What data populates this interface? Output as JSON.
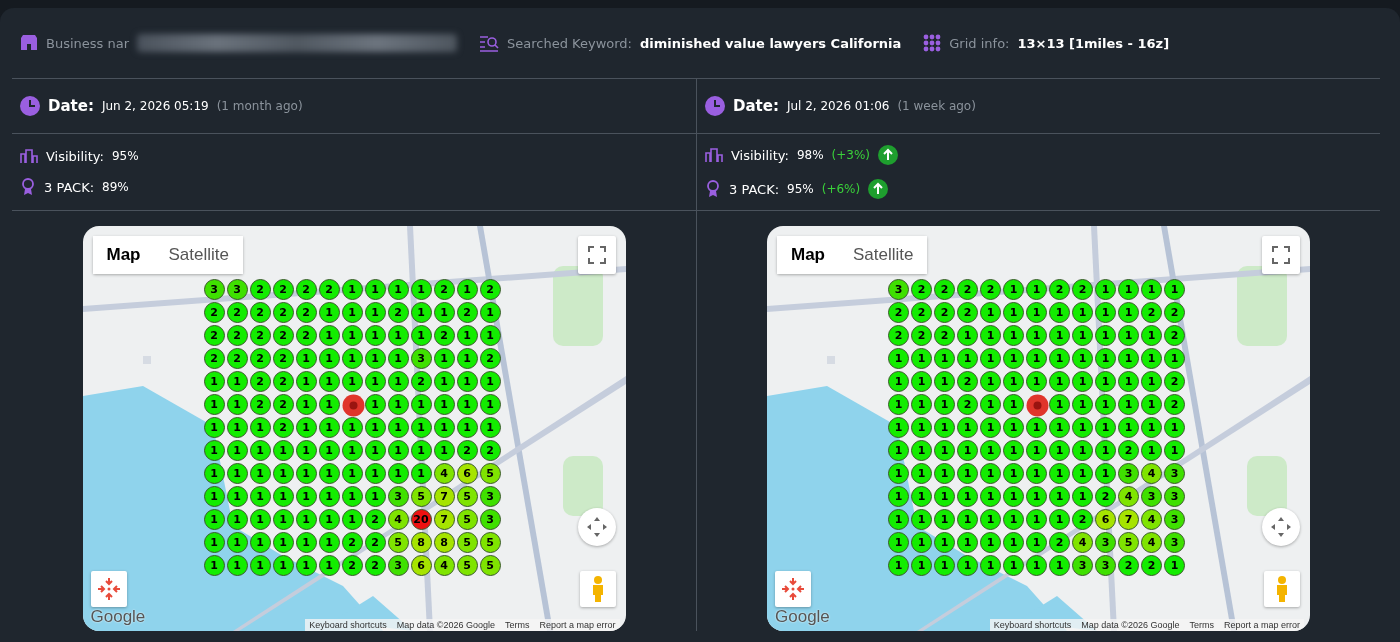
{
  "header": {
    "business_label": "Business nar",
    "keyword_label": "Searched Keyword:",
    "keyword": "diminished value lawyers California",
    "grid_label": "Grid info:",
    "grid_value": "13×13 [1miles - 16z]"
  },
  "reports": [
    {
      "date_label": "Date:",
      "date": "Jun 2, 2026 05:19",
      "ago": "(1 month ago)",
      "stats": [
        {
          "kind": "visibility",
          "label": "Visibility:",
          "value": "95%"
        },
        {
          "kind": "pack",
          "label": "3 PACK:",
          "value": "89%"
        }
      ],
      "map": {
        "map_types": [
          {
            "label": "Map",
            "selected": true
          },
          {
            "label": "Satellite",
            "selected": false
          }
        ],
        "logo": "Google",
        "footer": [
          "Keyboard shortcuts",
          "Map data ©2026 Google",
          "Terms",
          "Report a map error"
        ],
        "grid": [
          [
            "3",
            "3",
            "2",
            "2",
            "2",
            "2",
            "1",
            "1",
            "1",
            "1",
            "2",
            "1",
            "2"
          ],
          [
            "2",
            "2",
            "2",
            "2",
            "2",
            "1",
            "1",
            "1",
            "2",
            "1",
            "1",
            "2",
            "1"
          ],
          [
            "2",
            "2",
            "2",
            "2",
            "2",
            "1",
            "1",
            "1",
            "1",
            "1",
            "2",
            "1",
            "1"
          ],
          [
            "2",
            "2",
            "2",
            "2",
            "1",
            "1",
            "1",
            "1",
            "1",
            "3",
            "1",
            "1",
            "2"
          ],
          [
            "1",
            "1",
            "2",
            "2",
            "1",
            "1",
            "1",
            "1",
            "1",
            "2",
            "1",
            "1",
            "1"
          ],
          [
            "1",
            "1",
            "2",
            "2",
            "1",
            "1",
            {
              "kind": "pin"
            },
            "1",
            "1",
            "1",
            "1",
            "1",
            "1"
          ],
          [
            "1",
            "1",
            "1",
            "2",
            "1",
            "1",
            "1",
            "1",
            "1",
            "1",
            "1",
            "1",
            "1"
          ],
          [
            "1",
            "1",
            "1",
            "1",
            "1",
            "1",
            "1",
            "1",
            "1",
            "1",
            "1",
            "2",
            "2"
          ],
          [
            "1",
            "1",
            "1",
            "1",
            "1",
            "1",
            "1",
            "1",
            "1",
            "1",
            "4",
            "6",
            "5"
          ],
          [
            "1",
            "1",
            "1",
            "1",
            "1",
            "1",
            "1",
            "1",
            "3",
            "5",
            "7",
            "5",
            "3"
          ],
          [
            "1",
            "1",
            "1",
            "1",
            "1",
            "1",
            "1",
            "2",
            "4",
            "20",
            "7",
            "5",
            "3"
          ],
          [
            "1",
            "1",
            "1",
            "1",
            "1",
            "1",
            "2",
            "2",
            "5",
            "8",
            "8",
            "5",
            "5"
          ],
          [
            "1",
            "1",
            "1",
            "1",
            "1",
            "1",
            "2",
            "2",
            "3",
            "6",
            "4",
            "5",
            "5"
          ]
        ]
      }
    },
    {
      "date_label": "Date:",
      "date": "Jul 2, 2026 01:06",
      "ago": "(1 week ago)",
      "stats": [
        {
          "kind": "visibility",
          "label": "Visibility:",
          "value": "98%",
          "change": "(+3%)",
          "rising": true
        },
        {
          "kind": "pack",
          "label": "3 PACK:",
          "value": "95%",
          "change": "(+6%)",
          "rising": true
        }
      ],
      "map": {
        "map_types": [
          {
            "label": "Map",
            "selected": true
          },
          {
            "label": "Satellite",
            "selected": false
          }
        ],
        "logo": "Google",
        "footer": [
          "Keyboard shortcuts",
          "Map data ©2026 Google",
          "Terms",
          "Report a map error"
        ],
        "grid": [
          [
            "3",
            "2",
            "2",
            "2",
            "2",
            "1",
            "1",
            "2",
            "2",
            "1",
            "1",
            "1",
            "1"
          ],
          [
            "2",
            "2",
            "2",
            "2",
            "1",
            "1",
            "1",
            "1",
            "1",
            "1",
            "1",
            "2",
            "2"
          ],
          [
            "2",
            "2",
            "2",
            "1",
            "1",
            "1",
            "1",
            "1",
            "1",
            "1",
            "1",
            "1",
            "2"
          ],
          [
            "1",
            "1",
            "1",
            "1",
            "1",
            "1",
            "1",
            "1",
            "1",
            "1",
            "1",
            "1",
            "1"
          ],
          [
            "1",
            "1",
            "1",
            "2",
            "1",
            "1",
            "1",
            "1",
            "1",
            "1",
            "1",
            "1",
            "2"
          ],
          [
            "1",
            "1",
            "1",
            "2",
            "1",
            "1",
            {
              "kind": "pin"
            },
            "1",
            "1",
            "1",
            "1",
            "1",
            "2"
          ],
          [
            "1",
            "1",
            "1",
            "1",
            "1",
            "1",
            "1",
            "1",
            "1",
            "1",
            "1",
            "1",
            "1"
          ],
          [
            "1",
            "1",
            "1",
            "1",
            "1",
            "1",
            "1",
            "1",
            "1",
            "1",
            "2",
            "1",
            "1"
          ],
          [
            "1",
            "1",
            "1",
            "1",
            "1",
            "1",
            "1",
            "1",
            "1",
            "1",
            "3",
            "4",
            "3"
          ],
          [
            "1",
            "1",
            "1",
            "1",
            "1",
            "1",
            "1",
            "1",
            "1",
            "2",
            "4",
            "3",
            "3"
          ],
          [
            "1",
            "1",
            "1",
            "1",
            "1",
            "1",
            "1",
            "1",
            "2",
            "6",
            "7",
            "4",
            "3"
          ],
          [
            "1",
            "1",
            "1",
            "1",
            "1",
            "1",
            "1",
            "2",
            "4",
            "3",
            "5",
            "4",
            "3"
          ],
          [
            "1",
            "1",
            "1",
            "1",
            "1",
            "1",
            "1",
            "1",
            "3",
            "3",
            "2",
            "2",
            "1"
          ]
        ]
      }
    }
  ]
}
